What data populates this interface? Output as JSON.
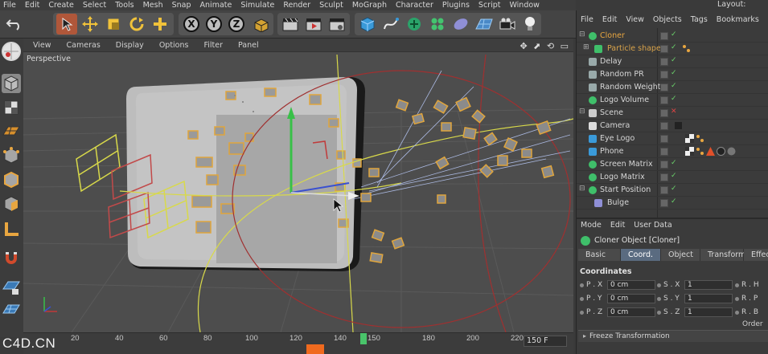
{
  "menu": [
    "File",
    "Edit",
    "Create",
    "Select",
    "Tools",
    "Mesh",
    "Snap",
    "Animate",
    "Simulate",
    "Render",
    "Sculpt",
    "MoGraph",
    "Character",
    "Plugins",
    "Script",
    "Window"
  ],
  "layout_label": "Layout:",
  "toolbar": {
    "axis_x": "X",
    "axis_y": "Y",
    "axis_z": "Z"
  },
  "viewport": {
    "menu": [
      "View",
      "Cameras",
      "Display",
      "Options",
      "Filter",
      "Panel"
    ],
    "camera_label": "Perspective"
  },
  "timeline": {
    "ticks": [
      "20",
      "40",
      "60",
      "80",
      "100",
      "120",
      "140",
      "150",
      "180",
      "200",
      "220"
    ],
    "end_frame": "150 F"
  },
  "watermark": "C4D.CN",
  "object_manager": {
    "menu": [
      "File",
      "Edit",
      "View",
      "Objects",
      "Tags",
      "Bookmarks"
    ],
    "objects": [
      {
        "name": "Cloner",
        "color": "#e8a640"
      },
      {
        "name": "Particle shape",
        "color": "#d9a34a"
      },
      {
        "name": "Delay",
        "color": "#d6d6d6"
      },
      {
        "name": "Random PR",
        "color": "#d6d6d6"
      },
      {
        "name": "Random Weight",
        "color": "#d6d6d6"
      },
      {
        "name": "Logo Volume",
        "color": "#d6d6d6"
      },
      {
        "name": "Scene",
        "color": "#d6d6d6"
      },
      {
        "name": "Camera",
        "color": "#d6d6d6"
      },
      {
        "name": "Eye Logo",
        "color": "#d6d6d6"
      },
      {
        "name": "Phone",
        "color": "#d6d6d6"
      },
      {
        "name": "Screen Matrix",
        "color": "#d6d6d6"
      },
      {
        "name": "Logo Matrix",
        "color": "#d6d6d6"
      },
      {
        "name": "Start Position",
        "color": "#d6d6d6"
      },
      {
        "name": "Bulge",
        "color": "#d6d6d6"
      }
    ]
  },
  "attribute_manager": {
    "menu": [
      "Mode",
      "Edit",
      "User Data"
    ],
    "title": "Cloner Object [Cloner]",
    "tabs": [
      "Basic",
      "Coord.",
      "Object",
      "Transform",
      "Effecto"
    ],
    "section": "Coordinates",
    "fields": [
      {
        "label": "P . X",
        "value": "0 cm",
        "slabel": "S . X",
        "svalue": "1",
        "rlabel": "R . H"
      },
      {
        "label": "P . Y",
        "value": "0 cm",
        "slabel": "S . Y",
        "svalue": "1",
        "rlabel": "R . P"
      },
      {
        "label": "P . Z",
        "value": "0 cm",
        "slabel": "S . Z",
        "svalue": "1",
        "rlabel": "R . B"
      }
    ],
    "order_label": "Order",
    "freeze_label": "Freeze Transformation"
  }
}
